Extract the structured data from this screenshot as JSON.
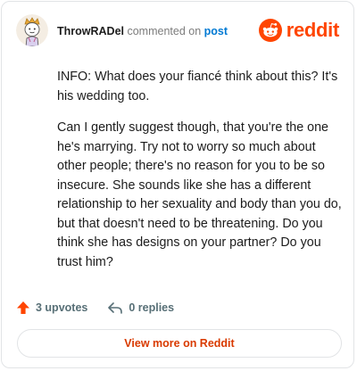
{
  "comment": {
    "username": "ThrowRADel",
    "action_text": "commented on",
    "post_link_text": "post",
    "paragraphs": [
      "INFO: What does your fiancé think about this? It's his wedding too.",
      "Can I gently suggest though, that you're the one he's marrying. Try not to worry so much about other people; there's no reason for you to be so insecure. She sounds like she has a different relationship to her sexuality and body than you do, but that doesn't need to be threatening. Do you think she has designs on your partner? Do you trust him?"
    ]
  },
  "brand": {
    "wordmark": "reddit",
    "color": "#ff4500"
  },
  "footer": {
    "upvotes_label": "3 upvotes",
    "replies_label": "0 replies",
    "upvote_color": "#ff4500"
  },
  "view_more_label": "View more on Reddit",
  "icons": {
    "avatar": "avatar-icon",
    "brand": "reddit-logo-icon",
    "upvote": "upvote-arrow-icon",
    "reply": "reply-icon"
  }
}
